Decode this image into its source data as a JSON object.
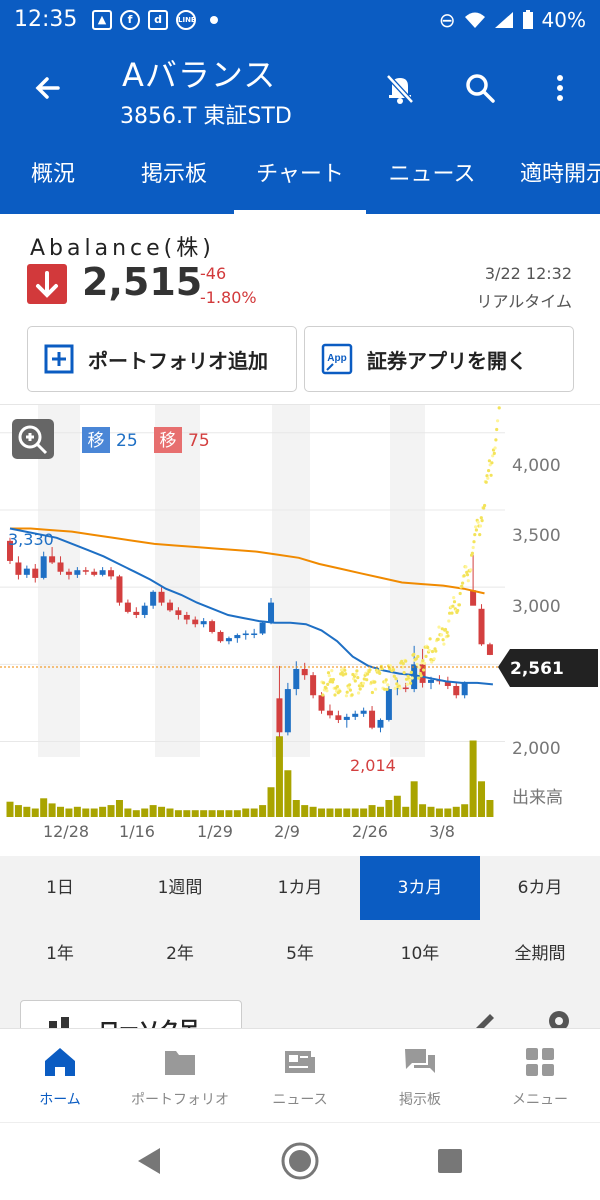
{
  "status_bar": {
    "time": "12:35",
    "battery": "40%",
    "notif_d": "d",
    "notif_line": "LINE"
  },
  "header": {
    "title": "Aバランス",
    "subtitle": "3856.T 東証STD"
  },
  "tabs": [
    {
      "label": "概況"
    },
    {
      "label": "掲示板"
    },
    {
      "label": "チャート"
    },
    {
      "label": "ニュース"
    },
    {
      "label": "適時開示"
    }
  ],
  "stock": {
    "name": "Abalance(株)",
    "price": "2,515",
    "change": "-46",
    "change_pct": "-1.80%",
    "timestamp": "3/22 12:32",
    "mode": "リアルタイム"
  },
  "buttons": {
    "portfolio_add": "ポートフォリオ追加",
    "open_securities_app": "証券アプリを開く",
    "app_icon_text": "App"
  },
  "chart": {
    "ma_icon": "移",
    "ma_short": "25",
    "ma_long": "75",
    "colors": {
      "ma_short": "#1e6fc4",
      "ma_long": "#f08a00",
      "up": "#1e6fc4",
      "down": "#d33f3f",
      "volume": "#a9a400"
    }
  },
  "chart_data": {
    "type": "candlestick",
    "y_ticks": [
      "4,000",
      "3,500",
      "3,000",
      "2,000"
    ],
    "x_ticks": [
      "12/28",
      "1/16",
      "1/29",
      "2/9",
      "2/26",
      "3/8"
    ],
    "volume_label": "出来高",
    "high_label": "3,330",
    "low_label": "2,014",
    "current_price_label": "2,561",
    "ylim": [
      1900,
      4180
    ],
    "candles": [
      [
        3300,
        3320,
        3150,
        3170
      ],
      [
        3160,
        3200,
        3050,
        3080
      ],
      [
        3080,
        3140,
        3060,
        3120
      ],
      [
        3120,
        3150,
        3030,
        3060
      ],
      [
        3060,
        3230,
        3050,
        3200
      ],
      [
        3200,
        3260,
        3150,
        3160
      ],
      [
        3160,
        3200,
        3080,
        3100
      ],
      [
        3100,
        3120,
        3050,
        3080
      ],
      [
        3080,
        3130,
        3060,
        3110
      ],
      [
        3110,
        3130,
        3080,
        3100
      ],
      [
        3100,
        3120,
        3070,
        3080
      ],
      [
        3080,
        3130,
        3070,
        3110
      ],
      [
        3110,
        3130,
        3050,
        3070
      ],
      [
        3070,
        3080,
        2880,
        2900
      ],
      [
        2900,
        2920,
        2830,
        2840
      ],
      [
        2840,
        2870,
        2800,
        2820
      ],
      [
        2820,
        2900,
        2800,
        2880
      ],
      [
        2880,
        2980,
        2860,
        2970
      ],
      [
        2970,
        3000,
        2880,
        2900
      ],
      [
        2900,
        2920,
        2840,
        2850
      ],
      [
        2850,
        2870,
        2790,
        2820
      ],
      [
        2820,
        2840,
        2760,
        2790
      ],
      [
        2790,
        2810,
        2740,
        2760
      ],
      [
        2760,
        2800,
        2740,
        2780
      ],
      [
        2780,
        2790,
        2700,
        2710
      ],
      [
        2710,
        2720,
        2640,
        2650
      ],
      [
        2650,
        2680,
        2630,
        2670
      ],
      [
        2670,
        2700,
        2640,
        2690
      ],
      [
        2690,
        2720,
        2660,
        2700
      ],
      [
        2700,
        2730,
        2670,
        2700
      ],
      [
        2700,
        2780,
        2690,
        2770
      ],
      [
        2770,
        2930,
        2760,
        2900
      ],
      [
        2280,
        2490,
        2030,
        2060
      ],
      [
        2060,
        2380,
        2040,
        2340
      ],
      [
        2340,
        2520,
        2300,
        2470
      ],
      [
        2470,
        2510,
        2400,
        2430
      ],
      [
        2430,
        2450,
        2280,
        2300
      ],
      [
        2300,
        2320,
        2180,
        2200
      ],
      [
        2200,
        2240,
        2150,
        2170
      ],
      [
        2170,
        2200,
        2120,
        2140
      ],
      [
        2140,
        2180,
        2090,
        2160
      ],
      [
        2160,
        2200,
        2140,
        2180
      ],
      [
        2180,
        2220,
        2160,
        2200
      ],
      [
        2200,
        2230,
        2080,
        2090
      ],
      [
        2090,
        2150,
        2060,
        2140
      ],
      [
        2140,
        2360,
        2130,
        2340
      ],
      [
        2340,
        2400,
        2300,
        2350
      ],
      [
        2350,
        2380,
        2320,
        2340
      ],
      [
        2340,
        2620,
        2320,
        2500
      ],
      [
        2500,
        2600,
        2350,
        2380
      ],
      [
        2380,
        2420,
        2340,
        2400
      ],
      [
        2400,
        2430,
        2370,
        2390
      ],
      [
        2390,
        2420,
        2340,
        2360
      ],
      [
        2360,
        2380,
        2280,
        2300
      ],
      [
        2300,
        2390,
        2280,
        2380
      ],
      [
        2980,
        3210,
        2900,
        2880
      ],
      [
        2860,
        2890,
        2620,
        2630
      ],
      [
        2630,
        2640,
        2560,
        2561
      ]
    ],
    "ma25": [
      3380,
      3360,
      3340,
      3320,
      3280,
      3240,
      3200,
      3150,
      3100,
      3050,
      2990,
      2950,
      2900,
      2860,
      2820,
      2800,
      2780,
      2770,
      2770,
      2760,
      2720,
      2650,
      2550,
      2490,
      2460,
      2440,
      2430,
      2410,
      2390,
      2380,
      2380,
      2370
    ],
    "ma75": [
      3380,
      3380,
      3370,
      3360,
      3340,
      3320,
      3300,
      3280,
      3270,
      3260,
      3250,
      3240,
      3230,
      3210,
      3190,
      3150,
      3120,
      3090,
      3060,
      3030,
      3020,
      3010,
      2990,
      2960
    ],
    "volume": [
      18,
      14,
      12,
      10,
      22,
      16,
      12,
      10,
      12,
      10,
      10,
      12,
      14,
      20,
      10,
      8,
      10,
      14,
      12,
      10,
      8,
      8,
      8,
      8,
      8,
      8,
      8,
      8,
      10,
      10,
      14,
      35,
      95,
      55,
      20,
      14,
      12,
      10,
      10,
      10,
      10,
      10,
      10,
      14,
      12,
      20,
      25,
      12,
      42,
      15,
      12,
      10,
      10,
      12,
      15,
      90,
      42,
      20
    ]
  },
  "periods": [
    "1日",
    "1週間",
    "1カ月",
    "3カ月",
    "6カ月",
    "1年",
    "2年",
    "5年",
    "10年",
    "全期間"
  ],
  "active_period": "3カ月",
  "chart_options": {
    "candle_label": "ローソク足"
  },
  "bottom_nav": [
    {
      "label": "ホーム"
    },
    {
      "label": "ポートフォリオ"
    },
    {
      "label": "ニュース"
    },
    {
      "label": "掲示板"
    },
    {
      "label": "メニュー"
    }
  ]
}
